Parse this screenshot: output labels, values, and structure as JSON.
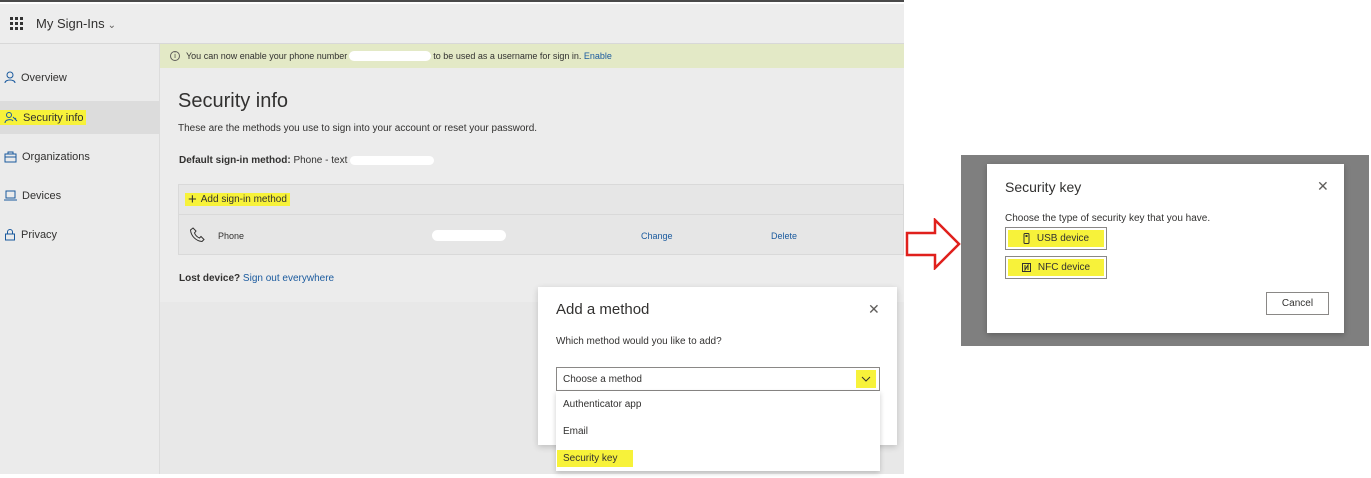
{
  "app": {
    "title": "My Sign-Ins"
  },
  "sidebar": {
    "items": [
      {
        "label": "Overview",
        "icon": "person-icon"
      },
      {
        "label": "Security info",
        "icon": "key-person-icon",
        "active": true
      },
      {
        "label": "Organizations",
        "icon": "briefcase-icon"
      },
      {
        "label": "Devices",
        "icon": "laptop-icon"
      },
      {
        "label": "Privacy",
        "icon": "lock-icon"
      }
    ]
  },
  "banner": {
    "text_before": "You can now enable your phone number",
    "text_after": "to be used as a username for sign in.",
    "action": "Enable"
  },
  "main": {
    "title": "Security info",
    "description": "These are the methods you use to sign into your account or reset your password.",
    "default_label": "Default sign-in method:",
    "default_value": "Phone - text",
    "add_method": "Add sign-in method",
    "methods": [
      {
        "name": "Phone",
        "change": "Change",
        "delete": "Delete"
      }
    ],
    "lost_label": "Lost device?",
    "lost_action": "Sign out everywhere"
  },
  "add_dialog": {
    "title": "Add a method",
    "question": "Which method would you like to add?",
    "select_value": "Choose a method",
    "options": [
      "Authenticator app",
      "Email",
      "Security key"
    ]
  },
  "security_key_dialog": {
    "title": "Security key",
    "description": "Choose the type of security key that you have.",
    "usb_label": "USB device",
    "nfc_label": "NFC device",
    "cancel_label": "Cancel"
  },
  "colors": {
    "highlight": "#f7f23a",
    "link": "#1a5a9e",
    "arrow": "#e0201c",
    "banner": "#e3e9c6"
  }
}
